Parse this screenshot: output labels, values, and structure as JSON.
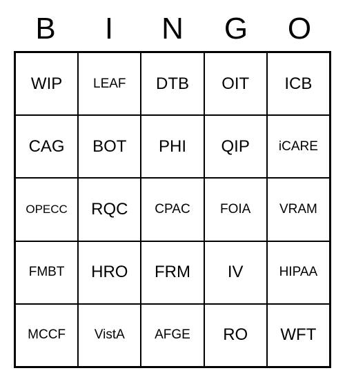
{
  "header": [
    "B",
    "I",
    "N",
    "G",
    "O"
  ],
  "grid": [
    [
      {
        "t": "WIP"
      },
      {
        "t": "LEAF",
        "s": "s"
      },
      {
        "t": "DTB"
      },
      {
        "t": "OIT"
      },
      {
        "t": "ICB"
      }
    ],
    [
      {
        "t": "CAG"
      },
      {
        "t": "BOT"
      },
      {
        "t": "PHI"
      },
      {
        "t": "QIP"
      },
      {
        "t": "iCARE",
        "s": "s"
      }
    ],
    [
      {
        "t": "OPECC",
        "s": "xs"
      },
      {
        "t": "RQC"
      },
      {
        "t": "CPAC",
        "s": "s"
      },
      {
        "t": "FOIA",
        "s": "s"
      },
      {
        "t": "VRAM",
        "s": "s"
      }
    ],
    [
      {
        "t": "FMBT",
        "s": "s"
      },
      {
        "t": "HRO"
      },
      {
        "t": "FRM"
      },
      {
        "t": "IV"
      },
      {
        "t": "HIPAA",
        "s": "s"
      }
    ],
    [
      {
        "t": "MCCF",
        "s": "s"
      },
      {
        "t": "VistA",
        "s": "s"
      },
      {
        "t": "AFGE",
        "s": "s"
      },
      {
        "t": "RO"
      },
      {
        "t": "WFT"
      }
    ]
  ]
}
